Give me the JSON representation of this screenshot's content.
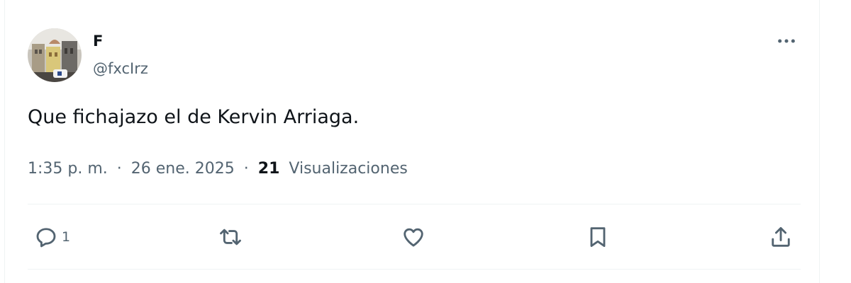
{
  "tweet": {
    "author_name": "F",
    "author_handle": "@fxcIrz",
    "text": "Que fichajazo el de Kervin Arriaga.",
    "time": "1:35 p. m.",
    "separator": "·",
    "date": "26 ene. 2025",
    "views_count": "21",
    "views_label": "Visualizaciones"
  },
  "actions": {
    "reply_count": "1",
    "icons": [
      "reply-icon",
      "retweet-icon",
      "like-icon",
      "bookmark-icon",
      "share-icon"
    ]
  },
  "colors": {
    "text_primary": "#0f1419",
    "text_secondary": "#536471",
    "divider": "#eff3f4",
    "icon": "#536471"
  }
}
